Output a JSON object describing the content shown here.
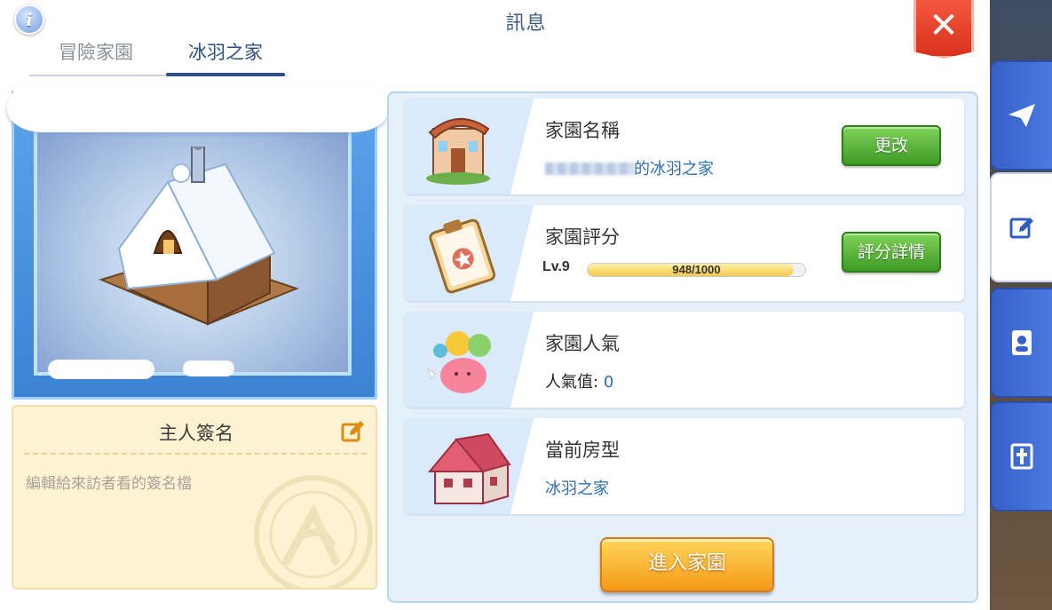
{
  "header": {
    "title": "訊息",
    "info_label": "i",
    "close_label": "✕"
  },
  "tabs": [
    {
      "label": "冒險家園",
      "active": false
    },
    {
      "label": "冰羽之家",
      "active": true
    }
  ],
  "signature": {
    "title": "主人簽名",
    "placeholder": "編輯給來訪者看的簽名檔"
  },
  "rows": {
    "name": {
      "label": "家園名稱",
      "value_suffix": "的冰羽之家",
      "button": "更改"
    },
    "rating": {
      "label": "家園評分",
      "level": "Lv.9",
      "progress_text": "948/1000",
      "progress_fraction": 0.948,
      "button": "評分詳情"
    },
    "popularity": {
      "label": "家園人氣",
      "value_label": "人氣值",
      "value_sep": ":",
      "value": "0"
    },
    "house_type": {
      "label": "當前房型",
      "value": "冰羽之家"
    }
  },
  "enter_button": "進入家園",
  "side_tabs": [
    {
      "icon": "send-icon",
      "active": false
    },
    {
      "icon": "edit-icon",
      "active": true
    },
    {
      "icon": "contact-book-icon",
      "active": false
    },
    {
      "icon": "guild-emblem-icon",
      "active": false
    }
  ],
  "colors": {
    "accent_blue": "#2c6fb3",
    "green_button": "#3f9a24",
    "orange_button": "#f59a17",
    "close_red": "#d8321d"
  }
}
